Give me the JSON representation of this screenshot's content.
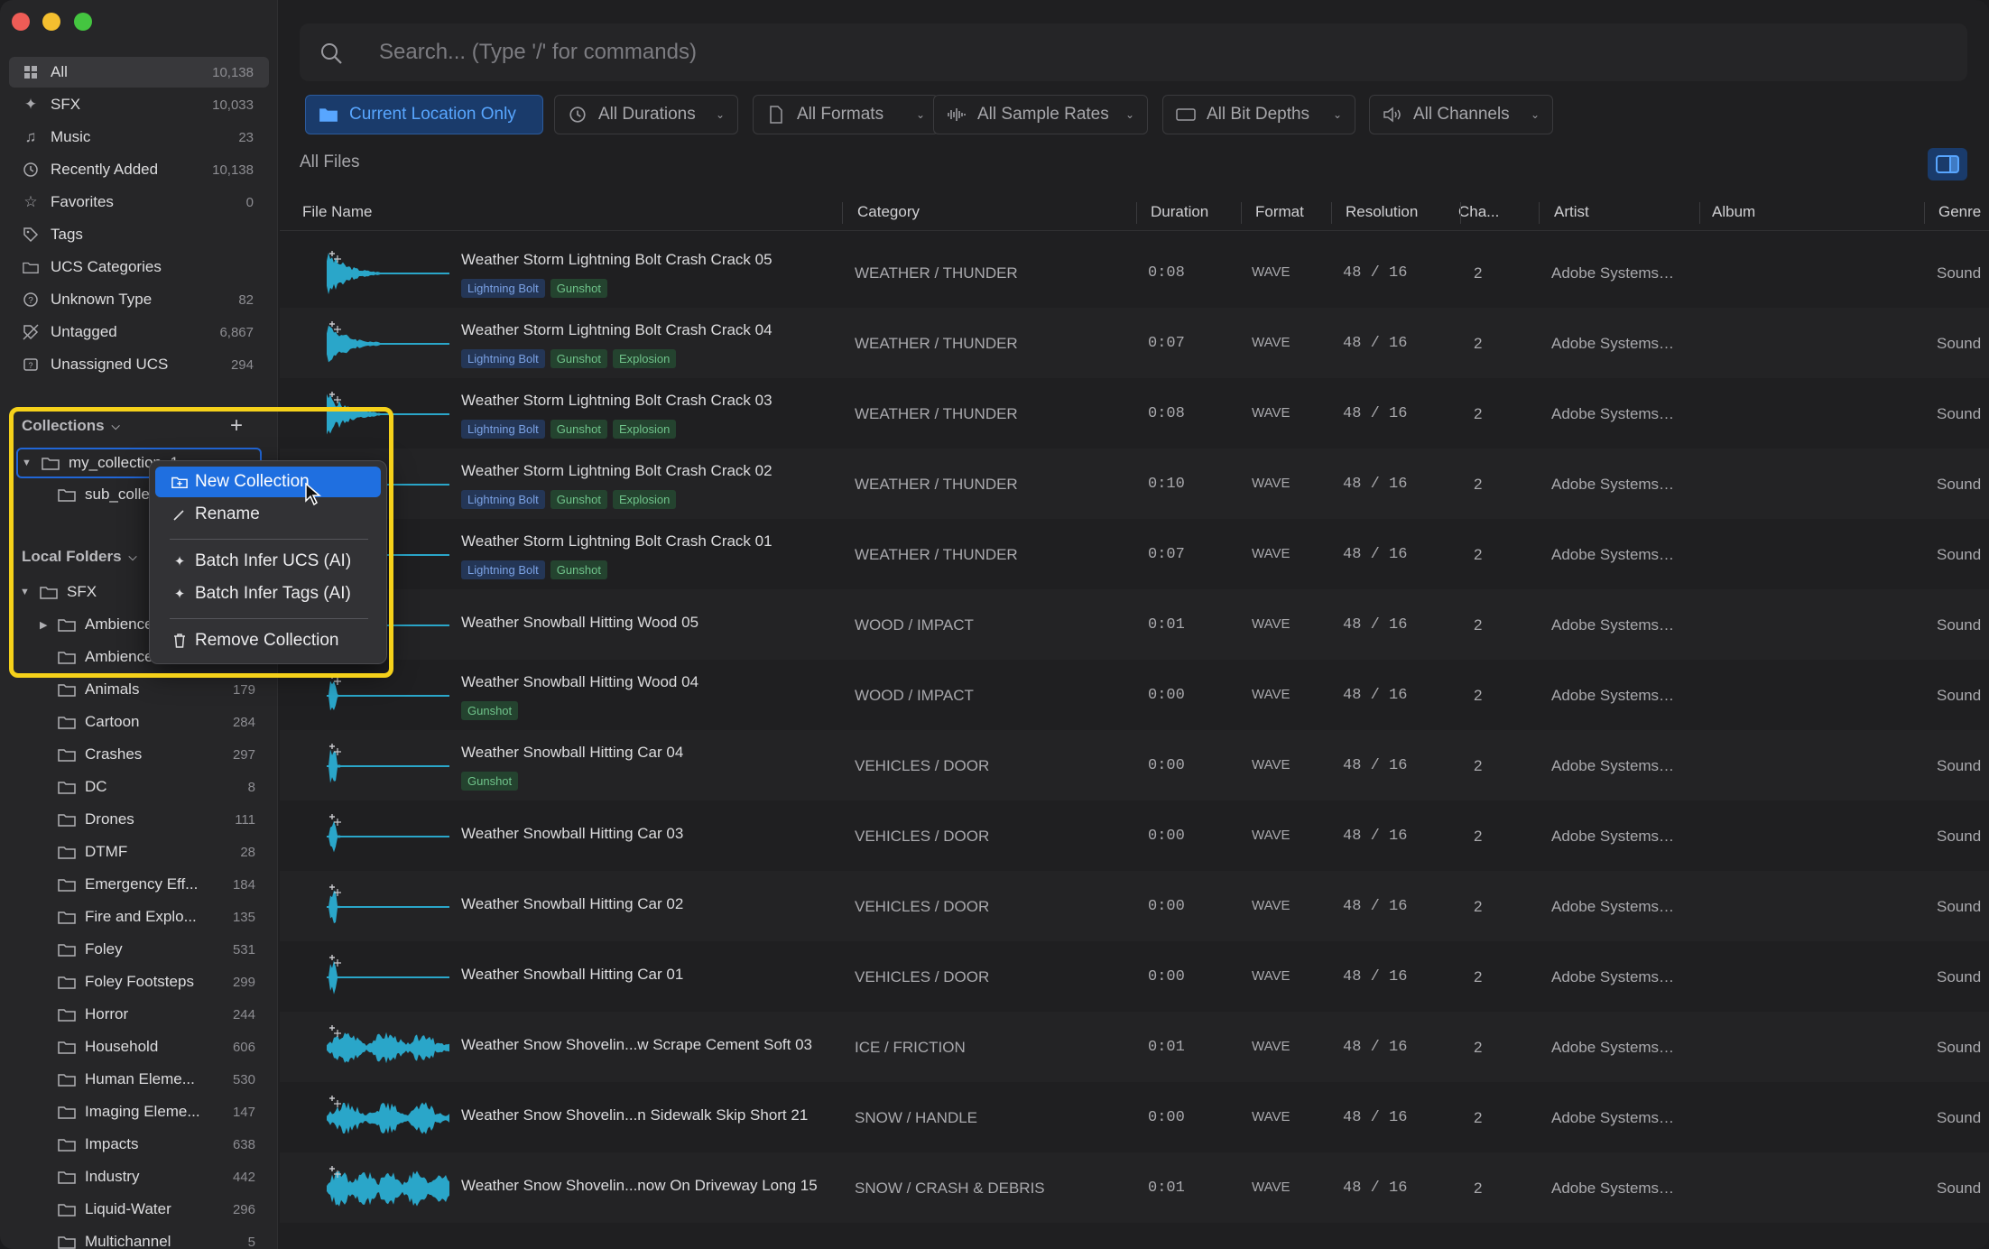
{
  "sidebar": {
    "library": [
      {
        "label": "All",
        "count": "10,138",
        "icon": "grid-icon"
      },
      {
        "label": "SFX",
        "count": "10,033",
        "icon": "sparkle-icon"
      },
      {
        "label": "Music",
        "count": "23",
        "icon": "music-note-icon"
      },
      {
        "label": "Recently Added",
        "count": "10,138",
        "icon": "clock-icon"
      },
      {
        "label": "Favorites",
        "count": "0",
        "icon": "star-icon"
      },
      {
        "label": "Tags",
        "count": "",
        "icon": "tag-icon"
      },
      {
        "label": "UCS Categories",
        "count": "",
        "icon": "folder-tree-icon"
      },
      {
        "label": "Unknown Type",
        "count": "82",
        "icon": "question-circle-icon"
      },
      {
        "label": "Untagged",
        "count": "6,867",
        "icon": "tag-slash-icon"
      },
      {
        "label": "Unassigned UCS",
        "count": "294",
        "icon": "ucs-box-icon"
      }
    ],
    "collections": {
      "header": "Collections",
      "items": [
        {
          "label": "my_collection_1"
        },
        {
          "label": "sub_collection"
        }
      ]
    },
    "local_folders": {
      "header": "Local Folders",
      "root": "SFX",
      "items": [
        {
          "label": "Ambience",
          "count": ""
        },
        {
          "label": "Ambience",
          "count": ""
        },
        {
          "label": "Animals",
          "count": "179"
        },
        {
          "label": "Cartoon",
          "count": "284"
        },
        {
          "label": "Crashes",
          "count": "297"
        },
        {
          "label": "DC",
          "count": "8"
        },
        {
          "label": "Drones",
          "count": "111"
        },
        {
          "label": "DTMF",
          "count": "28"
        },
        {
          "label": "Emergency Eff...",
          "count": "184"
        },
        {
          "label": "Fire and Explo...",
          "count": "135"
        },
        {
          "label": "Foley",
          "count": "531"
        },
        {
          "label": "Foley Footsteps",
          "count": "299"
        },
        {
          "label": "Horror",
          "count": "244"
        },
        {
          "label": "Household",
          "count": "606"
        },
        {
          "label": "Human Eleme...",
          "count": "530"
        },
        {
          "label": "Imaging Eleme...",
          "count": "147"
        },
        {
          "label": "Impacts",
          "count": "638"
        },
        {
          "label": "Industry",
          "count": "442"
        },
        {
          "label": "Liquid-Water",
          "count": "296"
        },
        {
          "label": "Multichannel",
          "count": "5"
        }
      ]
    }
  },
  "context_menu": {
    "items": [
      {
        "label": "New Collection",
        "icon": "folder-plus-icon"
      },
      {
        "label": "Rename",
        "icon": "pencil-icon"
      },
      {
        "label": "Batch Infer UCS (AI)",
        "icon": "sparkle-icon"
      },
      {
        "label": "Batch Infer Tags (AI)",
        "icon": "sparkle-icon"
      },
      {
        "label": "Remove Collection",
        "icon": "trash-icon"
      }
    ]
  },
  "search": {
    "placeholder": "Search... (Type '/' for commands)"
  },
  "filters": [
    {
      "label": "Current Location Only",
      "icon": "folder-icon"
    },
    {
      "label": "All Durations",
      "icon": "clock-icon"
    },
    {
      "label": "All Formats",
      "icon": "file-icon"
    },
    {
      "label": "All Sample Rates",
      "icon": "waveform-icon"
    },
    {
      "label": "All Bit Depths",
      "icon": "display-icon"
    },
    {
      "label": "All Channels",
      "icon": "speaker-icon"
    }
  ],
  "main": {
    "section_title": "All Files"
  },
  "table": {
    "columns": [
      "File Name",
      "Category",
      "Duration",
      "Format",
      "Resolution",
      "Cha...",
      "Artist",
      "Album",
      "Genre"
    ],
    "rows": [
      {
        "name": "Weather Storm Lightning Bolt Crash Crack 05",
        "tags": [
          "Lightning Bolt",
          "Gunshot"
        ],
        "category": "WEATHER / THUNDER",
        "duration": "0:08",
        "format": "WAVE",
        "resolution": "48 / 16",
        "channels": "2",
        "artist": "Adobe Systems…",
        "genre": "Sound",
        "wave": "burst"
      },
      {
        "name": "Weather Storm Lightning Bolt Crash Crack 04",
        "tags": [
          "Lightning Bolt",
          "Gunshot",
          "Explosion"
        ],
        "category": "WEATHER / THUNDER",
        "duration": "0:07",
        "format": "WAVE",
        "resolution": "48 / 16",
        "channels": "2",
        "artist": "Adobe Systems…",
        "genre": "Sound",
        "wave": "burst"
      },
      {
        "name": "Weather Storm Lightning Bolt Crash Crack 03",
        "tags": [
          "Lightning Bolt",
          "Gunshot",
          "Explosion"
        ],
        "category": "WEATHER / THUNDER",
        "duration": "0:08",
        "format": "WAVE",
        "resolution": "48 / 16",
        "channels": "2",
        "artist": "Adobe Systems…",
        "genre": "Sound",
        "wave": "burst"
      },
      {
        "name": "Weather Storm Lightning Bolt Crash Crack 02",
        "tags": [
          "Lightning Bolt",
          "Gunshot",
          "Explosion"
        ],
        "category": "WEATHER / THUNDER",
        "duration": "0:10",
        "format": "WAVE",
        "resolution": "48 / 16",
        "channels": "2",
        "artist": "Adobe Systems…",
        "genre": "Sound",
        "wave": "burst"
      },
      {
        "name": "Weather Storm Lightning Bolt Crash Crack 01",
        "tags": [
          "Lightning Bolt",
          "Gunshot"
        ],
        "category": "WEATHER / THUNDER",
        "duration": "0:07",
        "format": "WAVE",
        "resolution": "48 / 16",
        "channels": "2",
        "artist": "Adobe Systems…",
        "genre": "Sound",
        "wave": "burst"
      },
      {
        "name": "Weather Snowball Hitting Wood 05",
        "tags": [],
        "category": "WOOD / IMPACT",
        "duration": "0:01",
        "format": "WAVE",
        "resolution": "48 / 16",
        "channels": "2",
        "artist": "Adobe Systems…",
        "genre": "Sound",
        "wave": "spike"
      },
      {
        "name": "Weather Snowball Hitting Wood 04",
        "tags": [
          "Gunshot"
        ],
        "category": "WOOD / IMPACT",
        "duration": "0:00",
        "format": "WAVE",
        "resolution": "48 / 16",
        "channels": "2",
        "artist": "Adobe Systems…",
        "genre": "Sound",
        "wave": "spike"
      },
      {
        "name": "Weather Snowball Hitting Car 04",
        "tags": [
          "Gunshot"
        ],
        "category": "VEHICLES / DOOR",
        "duration": "0:00",
        "format": "WAVE",
        "resolution": "48 / 16",
        "channels": "2",
        "artist": "Adobe Systems…",
        "genre": "Sound",
        "wave": "spike"
      },
      {
        "name": "Weather Snowball Hitting Car 03",
        "tags": [],
        "category": "VEHICLES / DOOR",
        "duration": "0:00",
        "format": "WAVE",
        "resolution": "48 / 16",
        "channels": "2",
        "artist": "Adobe Systems…",
        "genre": "Sound",
        "wave": "spike"
      },
      {
        "name": "Weather Snowball Hitting Car 02",
        "tags": [],
        "category": "VEHICLES / DOOR",
        "duration": "0:00",
        "format": "WAVE",
        "resolution": "48 / 16",
        "channels": "2",
        "artist": "Adobe Systems…",
        "genre": "Sound",
        "wave": "spike"
      },
      {
        "name": "Weather Snowball Hitting Car 01",
        "tags": [],
        "category": "VEHICLES / DOOR",
        "duration": "0:00",
        "format": "WAVE",
        "resolution": "48 / 16",
        "channels": "2",
        "artist": "Adobe Systems…",
        "genre": "Sound",
        "wave": "spike"
      },
      {
        "name": "Weather Snow Shovelin...w Scrape Cement Soft 03",
        "tags": [],
        "category": "ICE / FRICTION",
        "duration": "0:01",
        "format": "WAVE",
        "resolution": "48 / 16",
        "channels": "2",
        "artist": "Adobe Systems…",
        "genre": "Sound",
        "wave": "noise"
      },
      {
        "name": "Weather Snow Shovelin...n Sidewalk Skip Short 21",
        "tags": [],
        "category": "SNOW / HANDLE",
        "duration": "0:00",
        "format": "WAVE",
        "resolution": "48 / 16",
        "channels": "2",
        "artist": "Adobe Systems…",
        "genre": "Sound",
        "wave": "noise"
      },
      {
        "name": "Weather Snow Shovelin...now On Driveway Long 15",
        "tags": [],
        "category": "SNOW / CRASH & DEBRIS",
        "duration": "0:01",
        "format": "WAVE",
        "resolution": "48 / 16",
        "channels": "2",
        "artist": "Adobe Systems…",
        "genre": "Sound",
        "wave": "dense"
      }
    ]
  },
  "colors": {
    "accent": "#1f6fe0",
    "highlight": "#f5d11a",
    "waveform": "#2aa6c9"
  }
}
